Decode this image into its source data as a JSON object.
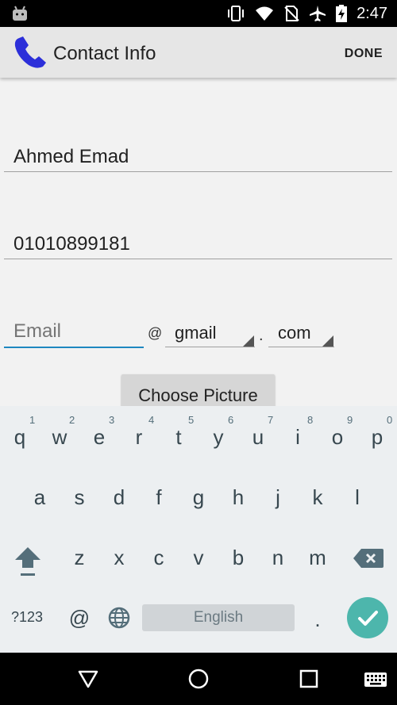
{
  "status_bar": {
    "time": "2:47"
  },
  "app_bar": {
    "title": "Contact Info",
    "done_label": "DONE"
  },
  "form": {
    "name_value": "Ahmed Emad",
    "phone_value": "01010899181",
    "email_placeholder": "Email",
    "at_symbol": "@",
    "domain_value": "gmail",
    "dot_symbol": ".",
    "tld_value": "com",
    "choose_picture_label": "Choose Picture"
  },
  "keyboard": {
    "row1": [
      "q",
      "w",
      "e",
      "r",
      "t",
      "y",
      "u",
      "i",
      "o",
      "p"
    ],
    "row1_hints": [
      "1",
      "2",
      "3",
      "4",
      "5",
      "6",
      "7",
      "8",
      "9",
      "0"
    ],
    "row2": [
      "a",
      "s",
      "d",
      "f",
      "g",
      "h",
      "j",
      "k",
      "l"
    ],
    "row3": [
      "z",
      "x",
      "c",
      "v",
      "b",
      "n",
      "m"
    ],
    "symbols_label": "?123",
    "at_key": "@",
    "space_label": "English",
    "period_key": ".",
    "accent_color": "#4db6ac"
  },
  "icons": {
    "app_logo": "phone-icon",
    "status": [
      "android-icon",
      "vibrate-icon",
      "wifi-icon",
      "no-sim-icon",
      "airplane-icon",
      "battery-charging-icon"
    ],
    "keyboard": [
      "shift-icon",
      "backspace-icon",
      "globe-icon",
      "checkmark-icon"
    ],
    "nav": [
      "back-icon",
      "home-icon",
      "recents-icon",
      "keyboard-icon"
    ]
  }
}
